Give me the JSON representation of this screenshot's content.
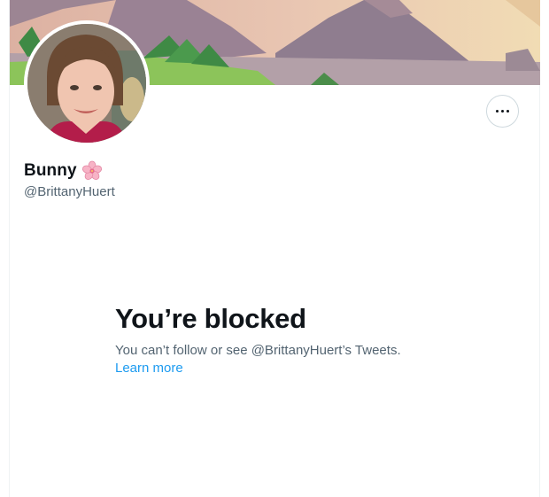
{
  "profile": {
    "display_name": "Bunny",
    "name_emoji_icon": "cherry-blossom-icon",
    "handle": "@BrittanyHuert",
    "more_icon": "more-horizontal-icon"
  },
  "blocked_notice": {
    "title": "You’re blocked",
    "description": "You can’t follow or see @BrittanyHuert’s Tweets.",
    "learn_more_label": "Learn more"
  },
  "colors": {
    "link": "#1d9bf0",
    "secondary_text": "#536471",
    "primary_text": "#0f1419",
    "border": "#cfd9de"
  }
}
